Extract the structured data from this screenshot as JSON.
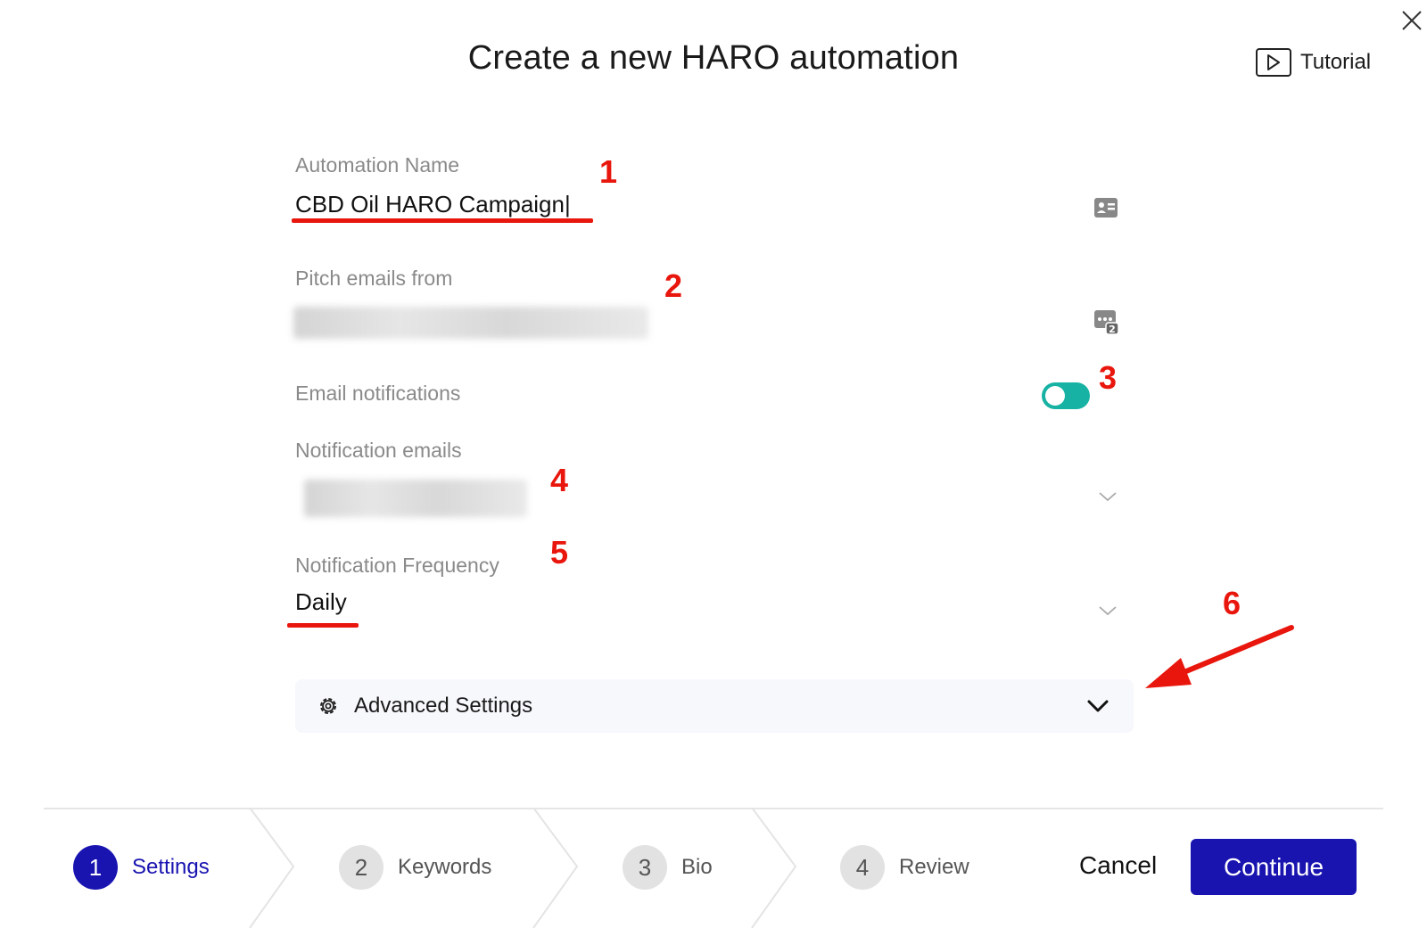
{
  "dialog": {
    "title": "Create a new HARO automation",
    "tutorial_label": "Tutorial"
  },
  "form": {
    "automation_name": {
      "label": "Automation Name",
      "value": "CBD Oil HARO Campaign|"
    },
    "pitch_emails_from": {
      "label": "Pitch emails from",
      "value": ""
    },
    "email_notifications": {
      "label": "Email notifications",
      "enabled": true
    },
    "notification_emails": {
      "label": "Notification emails",
      "value": ""
    },
    "notification_frequency": {
      "label": "Notification Frequency",
      "value": "Daily"
    },
    "advanced_settings": {
      "label": "Advanced Settings"
    }
  },
  "annotations": [
    "1",
    "2",
    "3",
    "4",
    "5",
    "6"
  ],
  "steps": [
    {
      "number": "1",
      "label": "Settings",
      "active": true
    },
    {
      "number": "2",
      "label": "Keywords",
      "active": false
    },
    {
      "number": "3",
      "label": "Bio",
      "active": false
    },
    {
      "number": "4",
      "label": "Review",
      "active": false
    }
  ],
  "footer": {
    "cancel_label": "Cancel",
    "continue_label": "Continue"
  },
  "colors": {
    "primary": "#1914b0",
    "toggle_on": "#17b2a3",
    "annotation_red": "#e8160c"
  },
  "icons": [
    "close-icon",
    "play-icon",
    "contact-card-icon",
    "email-template-icon",
    "chevron-down-icon",
    "gear-icon",
    "arrow-annotation-icon"
  ]
}
